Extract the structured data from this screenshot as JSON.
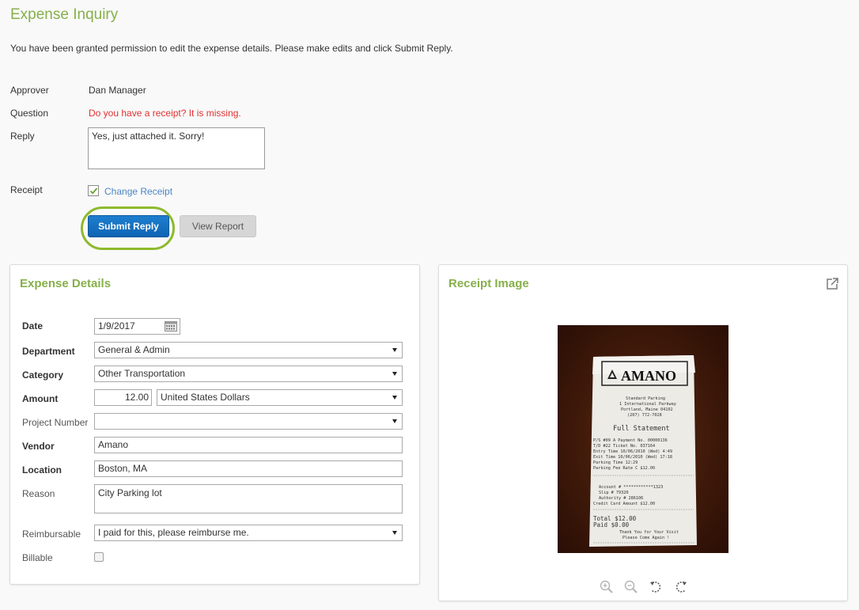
{
  "page": {
    "title": "Expense Inquiry",
    "intro": "You have been granted permission to edit the expense details. Please make edits and click Submit Reply."
  },
  "inquiry": {
    "approver_label": "Approver",
    "approver_value": "Dan Manager",
    "question_label": "Question",
    "question_value": "Do you have a receipt? It is missing.",
    "reply_label": "Reply",
    "reply_value": "Yes, just attached it. Sorry!",
    "receipt_label": "Receipt",
    "receipt_checked": true,
    "change_receipt_link": "Change Receipt",
    "submit_label": "Submit Reply",
    "view_report_label": "View Report"
  },
  "expense_details": {
    "title": "Expense Details",
    "date_label": "Date",
    "date_value": "1/9/2017",
    "department_label": "Department",
    "department_value": "General & Admin",
    "category_label": "Category",
    "category_value": "Other Transportation",
    "amount_label": "Amount",
    "amount_value": "12.00",
    "currency_value": "United States Dollars",
    "project_label": "Project Number",
    "project_value": "",
    "vendor_label": "Vendor",
    "vendor_value": "Amano",
    "location_label": "Location",
    "location_value": "Boston, MA",
    "reason_label": "Reason",
    "reason_value": "City Parking lot",
    "reimbursable_label": "Reimbursable",
    "reimbursable_value": "I paid for this, please reimburse me.",
    "billable_label": "Billable",
    "billable_checked": false
  },
  "receipt_image": {
    "title": "Receipt Image",
    "receipt_text": {
      "logo": "AMANO",
      "lines": [
        "Standard Parking",
        "1 International Parkway",
        "Portland, Maine 04102",
        "(207) 772-7028",
        "Full Statement",
        "P/S #09   A Payment No. 00000136",
        "T/D #22         Ticket No. 037164",
        "Entry Time 10/06/2010 (Wed)  4:49",
        "Exit Time  10/06/2010 (Wed) 17:18",
        "Parking Time               12:29",
        "Parking Fee    Rate C     $12.00",
        "Account #       ************1323",
        "Slip #                     79320",
        "Authority #               286106",
        "Credit Card Amount        $12.00",
        "Total                     $12.00",
        "Paid                       $0.00",
        "Thank You for Your Visit",
        "Please Come Again !"
      ]
    },
    "tools": [
      "zoom-in-icon",
      "zoom-out-icon",
      "rotate-left-icon",
      "rotate-right-icon"
    ]
  },
  "colors": {
    "title_green": "#86b04a",
    "question_red": "#e03232",
    "link_blue": "#4a86c5",
    "primary_blue": "#1274c4",
    "highlight_green": "#8dba2c"
  }
}
